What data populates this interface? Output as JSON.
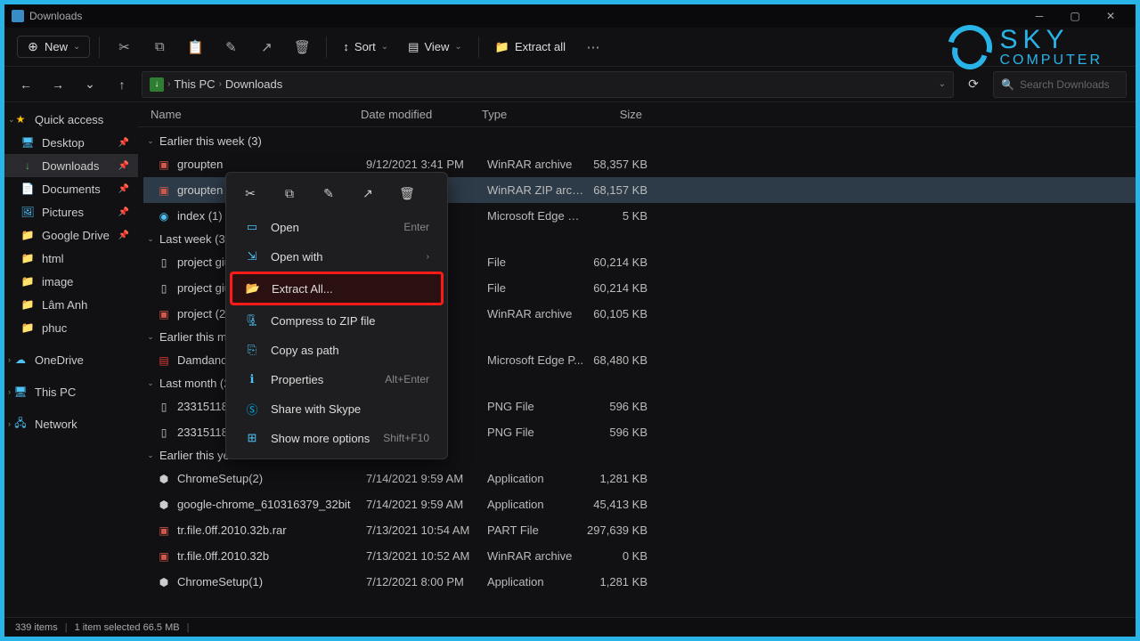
{
  "window": {
    "title": "Downloads"
  },
  "toolbar": {
    "new": "New",
    "sort": "Sort",
    "view": "View",
    "extract_all": "Extract all"
  },
  "breadcrumb": {
    "pc": "This PC",
    "loc": "Downloads"
  },
  "search": {
    "placeholder": "Search Downloads"
  },
  "sidebar": {
    "quick": "Quick access",
    "items": [
      {
        "label": "Desktop"
      },
      {
        "label": "Downloads"
      },
      {
        "label": "Documents"
      },
      {
        "label": "Pictures"
      },
      {
        "label": "Google Drive"
      },
      {
        "label": "html"
      },
      {
        "label": "image"
      },
      {
        "label": "Lâm Anh"
      },
      {
        "label": "phuc"
      }
    ],
    "onedrive": "OneDrive",
    "thispc": "This PC",
    "network": "Network"
  },
  "columns": {
    "name": "Name",
    "date": "Date modified",
    "type": "Type",
    "size": "Size"
  },
  "groups": {
    "g0": "Earlier this week (3)",
    "g1": "Last week (3)",
    "g2": "Earlier this m",
    "g3": "Last month (2",
    "g4": "Earlier this year"
  },
  "files": [
    {
      "name": "groupten",
      "date": "9/12/2021 3:41 PM",
      "type": "WinRAR archive",
      "size": "58,357 KB"
    },
    {
      "name": "groupten",
      "date": "",
      "type": "WinRAR ZIP archive",
      "size": "68,157 KB"
    },
    {
      "name": "index (1)",
      "date": "",
      "type": "Microsoft Edge H...",
      "size": "5 KB"
    },
    {
      "name": "project giuak",
      "date": "",
      "type": "File",
      "size": "60,214 KB"
    },
    {
      "name": "project giuak",
      "date": "",
      "type": "File",
      "size": "60,214 KB"
    },
    {
      "name": "project (2)",
      "date": "",
      "type": "WinRAR archive",
      "size": "60,105 KB"
    },
    {
      "name": "Damdandau",
      "date": "",
      "type": "Microsoft Edge P...",
      "size": "68,480 KB"
    },
    {
      "name": "233151189_10",
      "date": "",
      "type": "PNG File",
      "size": "596 KB"
    },
    {
      "name": "233151189_10",
      "date": "",
      "type": "PNG File",
      "size": "596 KB"
    },
    {
      "name": "ChromeSetup(2)",
      "date": "7/14/2021 9:59 AM",
      "type": "Application",
      "size": "1,281 KB"
    },
    {
      "name": "google-chrome_610316379_32bit",
      "date": "7/14/2021 9:59 AM",
      "type": "Application",
      "size": "45,413 KB"
    },
    {
      "name": "tr.file.0ff.2010.32b.rar",
      "date": "7/13/2021 10:54 AM",
      "type": "PART File",
      "size": "297,639 KB"
    },
    {
      "name": "tr.file.0ff.2010.32b",
      "date": "7/13/2021 10:52 AM",
      "type": "WinRAR archive",
      "size": "0 KB"
    },
    {
      "name": "ChromeSetup(1)",
      "date": "7/12/2021 8:00 PM",
      "type": "Application",
      "size": "1,281 KB"
    }
  ],
  "context_menu": {
    "open": "Open",
    "open_enter": "Enter",
    "open_with": "Open with",
    "extract_all": "Extract All...",
    "compress": "Compress to ZIP file",
    "copy_path": "Copy as path",
    "properties": "Properties",
    "properties_short": "Alt+Enter",
    "share_skype": "Share with Skype",
    "show_more": "Show more options",
    "show_more_short": "Shift+F10"
  },
  "status": {
    "items": "339 items",
    "selected": "1 item selected  66.5 MB"
  },
  "logo": {
    "line1": "SKY",
    "line2": "COMPUTER"
  }
}
